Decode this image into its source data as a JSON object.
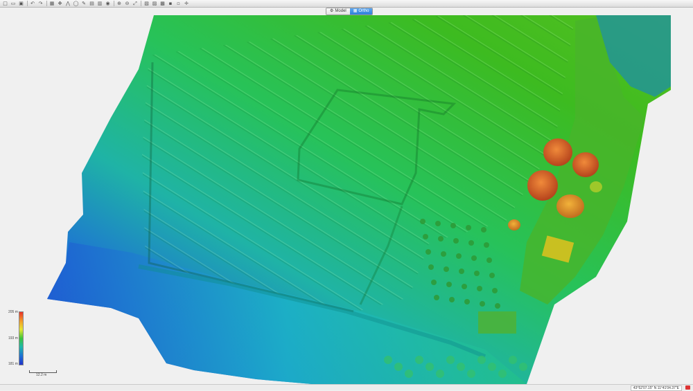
{
  "toolbar": {
    "icons": [
      "new-icon",
      "open-icon",
      "save-icon",
      "undo-icon",
      "redo-icon",
      "select-icon",
      "pan-icon",
      "measure-distance-icon",
      "measure-area-icon",
      "draw-icon",
      "layers-icon",
      "grid-icon",
      "annotate-icon",
      "zoom-in-icon",
      "zoom-out-icon",
      "zoom-fit-icon",
      "camera-icon",
      "shapes-icon",
      "image-icon",
      "export-icon",
      "settings-icon",
      "move-icon"
    ],
    "glyphs": [
      "□",
      "▭",
      "▣",
      "↶",
      "↷",
      "▦",
      "✥",
      "⋀",
      "◯",
      "✎",
      "▤",
      "▥",
      "◉",
      "⊕",
      "⊖",
      "⤢",
      "▧",
      "▨",
      "▩",
      "▪",
      "▫",
      "✛"
    ]
  },
  "mode_switch": {
    "model_label": "Model",
    "ortho_label": "Ortho",
    "active": "Ortho"
  },
  "legend": {
    "max_label": "205 m",
    "mid_label": "193 m",
    "min_label": "181 m",
    "colors": [
      "#e8332a",
      "#e6e633",
      "#3cc43c",
      "#1fb8a8",
      "#2233c8"
    ]
  },
  "scale": {
    "label": "12.2 m"
  },
  "status": {
    "coordinates": "43°52'07.15\" N  11°41'04.37\"E"
  }
}
